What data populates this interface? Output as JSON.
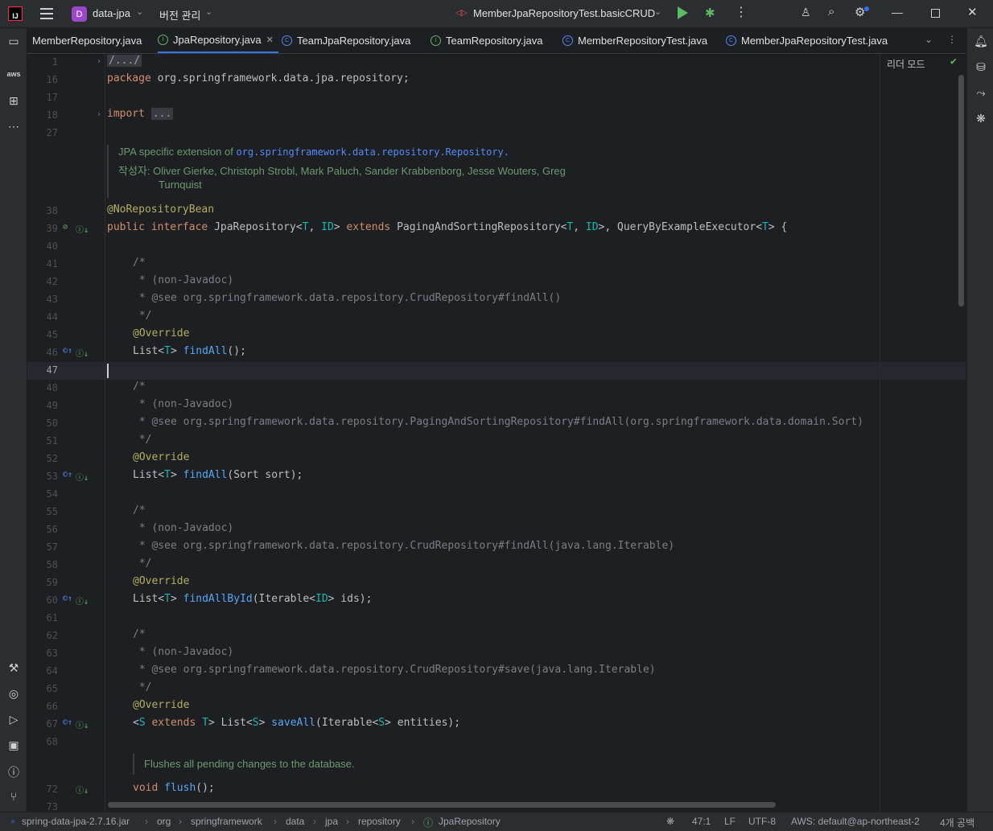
{
  "titlebar": {
    "project_badge": "D",
    "project_name": "data-jpa",
    "vcs_label": "버전 관리",
    "run_config": "MemberJpaRepositoryTest.basicCRUD"
  },
  "tabs": [
    {
      "label": "MemberRepository.java",
      "icon": "none"
    },
    {
      "label": "JpaRepository.java",
      "icon": "interface",
      "active": true
    },
    {
      "label": "TeamJpaRepository.java",
      "icon": "class"
    },
    {
      "label": "TeamRepository.java",
      "icon": "interface"
    },
    {
      "label": "MemberRepositoryTest.java",
      "icon": "class"
    },
    {
      "label": "MemberJpaRepositoryTest.java",
      "icon": "class"
    }
  ],
  "editor": {
    "reader_mode": "리더 모드",
    "line_numbers": {
      "l1": "1",
      "l16": "16",
      "l17": "17",
      "l18": "18",
      "l27": "27",
      "l38": "38",
      "l39": "39",
      "l40": "40",
      "l41": "41",
      "l42": "42",
      "l43": "43",
      "l44": "44",
      "l45": "45",
      "l46": "46",
      "l47": "47",
      "l48": "48",
      "l49": "49",
      "l50": "50",
      "l51": "51",
      "l52": "52",
      "l53": "53",
      "l54": "54",
      "l55": "55",
      "l56": "56",
      "l57": "57",
      "l58": "58",
      "l59": "59",
      "l60": "60",
      "l61": "61",
      "l62": "62",
      "l63": "63",
      "l64": "64",
      "l65": "65",
      "l66": "66",
      "l67": "67",
      "l68": "68",
      "l72": "72",
      "l73": "73"
    },
    "folded_header": "/.../",
    "package_kw": "package",
    "package_name": " org.springframework.data.jpa.repository;",
    "import_kw": "import",
    "import_folded": "...",
    "doc_main_text": "JPA specific extension of ",
    "doc_main_link": "org.springframework.data.repository.Repository.",
    "doc_author_label": "작성자:",
    "doc_author_line1": "Oliver Gierke, Christoph Strobl, Mark Paluch, Sander Krabbenborg, Jesse Wouters, Greg",
    "doc_author_line2": "Turnquist",
    "annotation_norepo": "@NoRepositoryBean",
    "iface_public": "public ",
    "iface_interface": "interface ",
    "iface_name": "JpaRepository<",
    "iface_t": "T",
    "iface_comma1": ", ",
    "iface_id": "ID",
    "iface_gt1": "> ",
    "iface_extends": "extends ",
    "iface_paging": "PagingAndSortingRepository<",
    "iface_t2": "T",
    "iface_comma2": ", ",
    "iface_id2": "ID",
    "iface_gt2": ">, QueryByExampleExecutor<",
    "iface_t3": "T",
    "iface_end": "> {",
    "comment_open": "/*",
    "comment_nonjavadoc": " * (non-Javadoc)",
    "comment_close": " */",
    "see_findall": " * @see org.springframework.data.repository.CrudRepository#findAll()",
    "see_findall_sort": " * @see org.springframework.data.repository.PagingAndSortingRepository#findAll(org.springframework.data.domain.Sort)",
    "see_findall_iter": " * @see org.springframework.data.repository.CrudRepository#findAll(java.lang.Iterable)",
    "see_save_iter": " * @see org.springframework.data.repository.CrudRepository#save(java.lang.Iterable)",
    "override": "@Override",
    "list_open": "List<",
    "t": "T",
    "gt_space": "> ",
    "m_findall": "findAll",
    "args_empty": "();",
    "args_sort": "(Sort sort);",
    "m_findallbyid": "findAllById",
    "args_iter_open": "(Iterable<",
    "id": "ID",
    "args_ids": "> ids);",
    "s_lt": "<",
    "s": "S",
    "s_extends": " extends ",
    "s_t": "T",
    "s_list": "> List<",
    "s2": "S",
    "m_saveall": "saveAll",
    "s3": "S",
    "args_entities": "> entities);",
    "doc_flush": "Flushes all pending changes to the database.",
    "void_kw": "void ",
    "m_flush": "flush",
    "flush_end": "();"
  },
  "statusbar": {
    "crumbs": [
      "spring-data-jpa-2.7.16.jar",
      "org",
      "springframework",
      "data",
      "jpa",
      "repository",
      "JpaRepository"
    ],
    "position": "47:1",
    "line_sep": "LF",
    "encoding": "UTF-8",
    "aws": "AWS: default@ap-northeast-2",
    "indent": "4개 공백"
  },
  "colors": {
    "background": "#1e1f22",
    "panel": "#2b2d30",
    "accent": "#3574f0",
    "keyword": "#cf8e6d",
    "annotation": "#b3ae60",
    "method": "#56a8f5",
    "type_param": "#16baac",
    "comment": "#7a7e85"
  }
}
